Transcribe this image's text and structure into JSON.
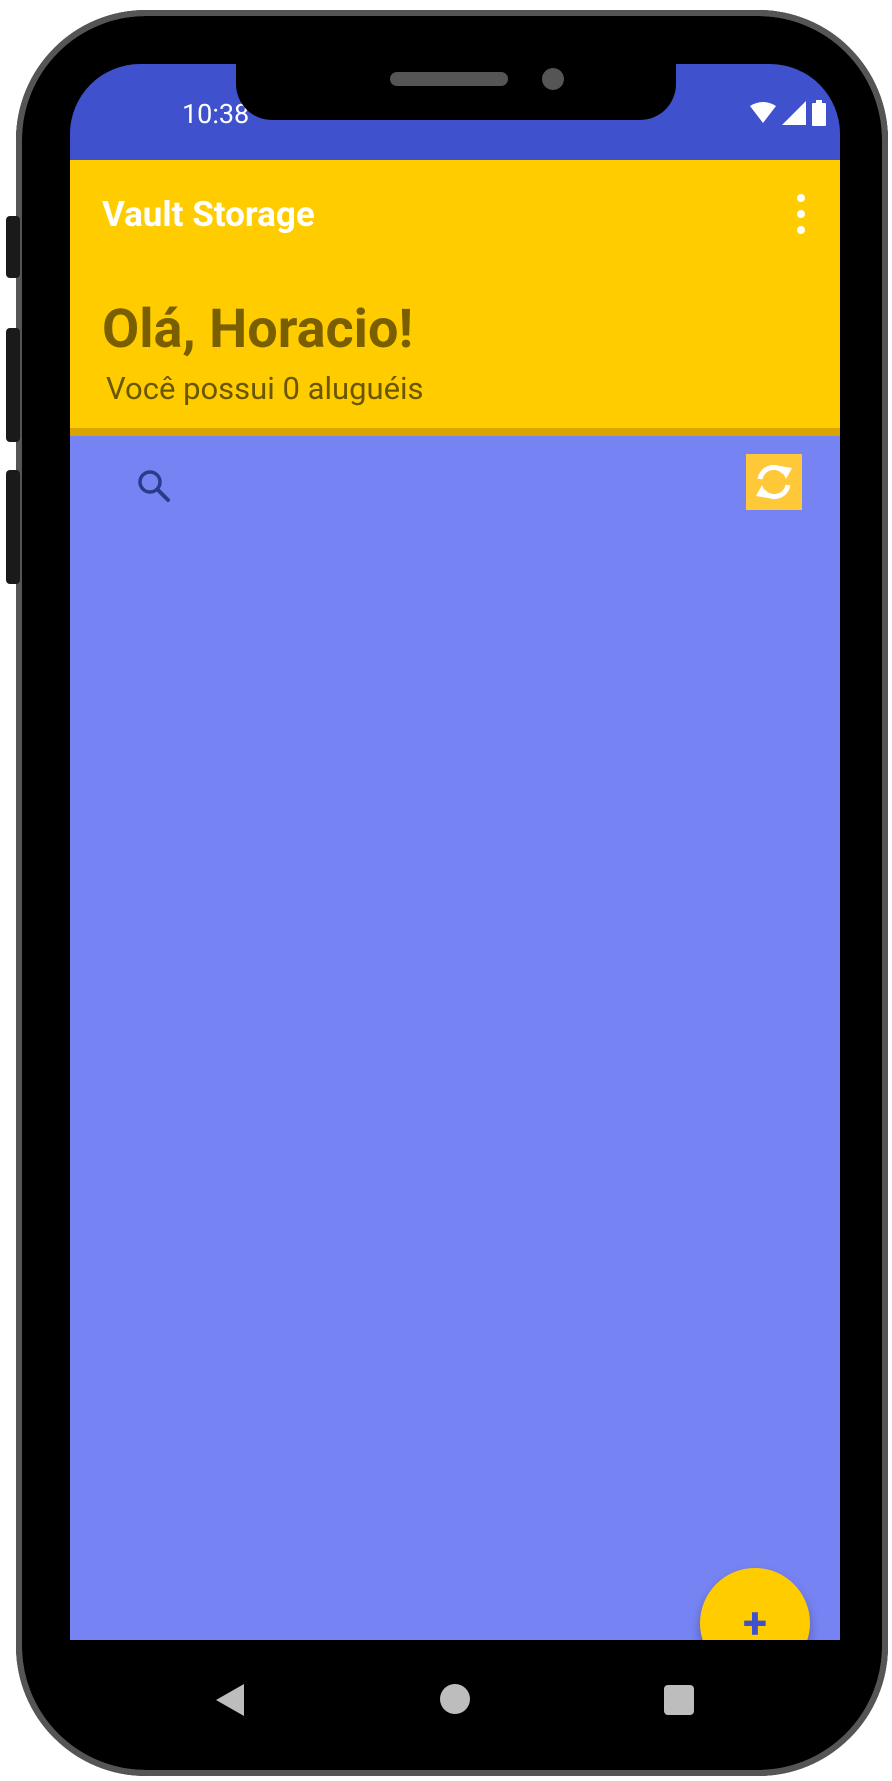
{
  "status_bar": {
    "time": "10:38",
    "icons": [
      "wifi-icon",
      "signal-icon",
      "battery-icon"
    ]
  },
  "app_bar": {
    "title": "Vault Storage",
    "menu_icon": "more-vertical-icon"
  },
  "header": {
    "greeting": "Olá, Horacio!",
    "rentals_text": "Você possui 0 aluguéis"
  },
  "toolbar": {
    "search_icon": "search-icon",
    "refresh_icon": "refresh-icon"
  },
  "fab": {
    "label": "+"
  },
  "nav_bar": {
    "icons": [
      "back-icon",
      "home-icon",
      "recents-icon"
    ]
  },
  "colors": {
    "primary": "#3f51cc",
    "accent": "#ffcc00",
    "content_background": "#7683f2"
  }
}
